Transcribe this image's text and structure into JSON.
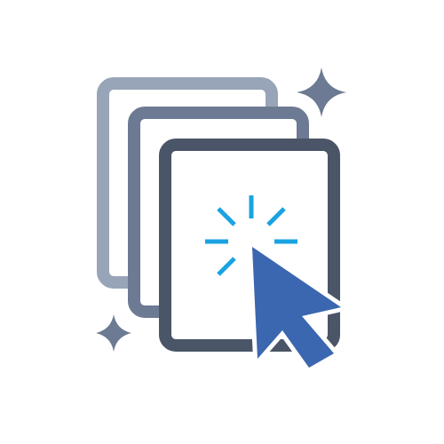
{
  "icon": {
    "name": "stacked-pages-click-icon",
    "colors": {
      "background": "#ffffff",
      "page_back": "#98a4b8",
      "page_middle": "#6c7a93",
      "page_front": "#4a5567",
      "sparkle": "#6c7a93",
      "click_burst": "#1aa3e2",
      "cursor_fill": "#3b66b0",
      "cursor_outline": "#ffffff"
    }
  }
}
